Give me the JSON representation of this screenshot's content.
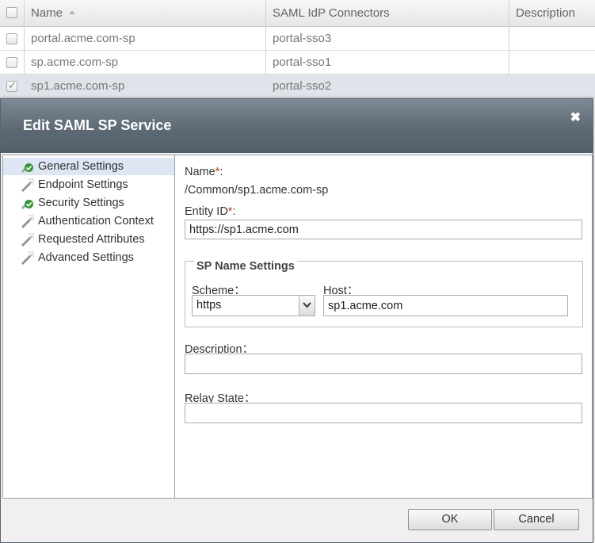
{
  "table": {
    "columns": [
      "Name",
      "SAML IdP Connectors",
      "Description"
    ],
    "rows": [
      {
        "name": "portal.acme.com-sp",
        "connector": "portal-sso3",
        "description": "",
        "checked": false
      },
      {
        "name": "sp.acme.com-sp",
        "connector": "portal-sso1",
        "description": "",
        "checked": false
      },
      {
        "name": "sp1.acme.com-sp",
        "connector": "portal-sso2",
        "description": "",
        "checked": true
      }
    ],
    "sort_icon": "sort-ascending-icon"
  },
  "dialog": {
    "title": "Edit SAML SP Service",
    "close_icon": "close-icon",
    "nav": [
      {
        "label": "General Settings",
        "icon": "check-badge-icon",
        "status": "complete",
        "active": true
      },
      {
        "label": "Endpoint Settings",
        "icon": "pencil-icon",
        "status": "editable",
        "active": false
      },
      {
        "label": "Security Settings",
        "icon": "check-badge-icon",
        "status": "complete",
        "active": false
      },
      {
        "label": "Authentication Context",
        "icon": "pencil-icon",
        "status": "editable",
        "active": false
      },
      {
        "label": "Requested Attributes",
        "icon": "pencil-icon",
        "status": "editable",
        "active": false
      },
      {
        "label": "Advanced Settings",
        "icon": "pencil-icon",
        "status": "editable",
        "active": false
      }
    ],
    "form": {
      "name_label": "Name",
      "name_value": "/Common/sp1.acme.com-sp",
      "entity_id_label": "Entity ID",
      "entity_id_value": "https://sp1.acme.com",
      "required_mark": "*",
      "colon": ":",
      "sp_name_settings": {
        "legend": "SP Name Settings",
        "scheme_label": "Scheme：",
        "scheme_value": "https",
        "host_label": "Host：",
        "host_value": "sp1.acme.com"
      },
      "description_label": "Description：",
      "description_value": "",
      "relay_state_label": "Relay State：",
      "relay_state_value": ""
    },
    "buttons": {
      "ok": "OK",
      "cancel": "Cancel"
    }
  },
  "colors": {
    "header_gradient_top": "#7d8a94",
    "header_gradient_bottom": "#525e68",
    "active_nav_bg": "#dde6f2",
    "required_mark": "#d9301c",
    "selected_row_bg": "#dfe3ea"
  }
}
